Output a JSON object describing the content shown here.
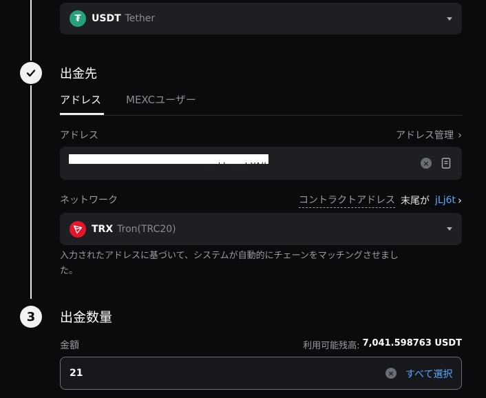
{
  "currency": {
    "symbol": "USDT",
    "name": "Tether",
    "icon": "tether-icon",
    "color": "#26a17b"
  },
  "step2": {
    "title": "出金先"
  },
  "tabs": [
    {
      "label": "アドレス",
      "active": true
    },
    {
      "label": "MEXCユーザー",
      "active": false
    }
  ],
  "address": {
    "label": "アドレス",
    "manage_link": "アドレス管理",
    "value_visible": "qa; kkuuuI YAll"
  },
  "network": {
    "label": "ネットワーク",
    "contract_label": "コントラクトアドレス",
    "suffix_label": "末尾が",
    "suffix_value": "jLj6t",
    "symbol": "TRX",
    "name": "Tron(TRC20)",
    "icon": "tron-icon",
    "color": "#e5162b",
    "hint": "入力されたアドレスに基づいて、システムが自動的にチェーンをマッチングさせました。"
  },
  "step3": {
    "number": "3",
    "title": "出金数量"
  },
  "amount": {
    "label": "金額",
    "balance_label": "利用可能残高:",
    "balance_value": "7,041.598763 USDT",
    "value": "21",
    "select_all": "すべて選択"
  }
}
